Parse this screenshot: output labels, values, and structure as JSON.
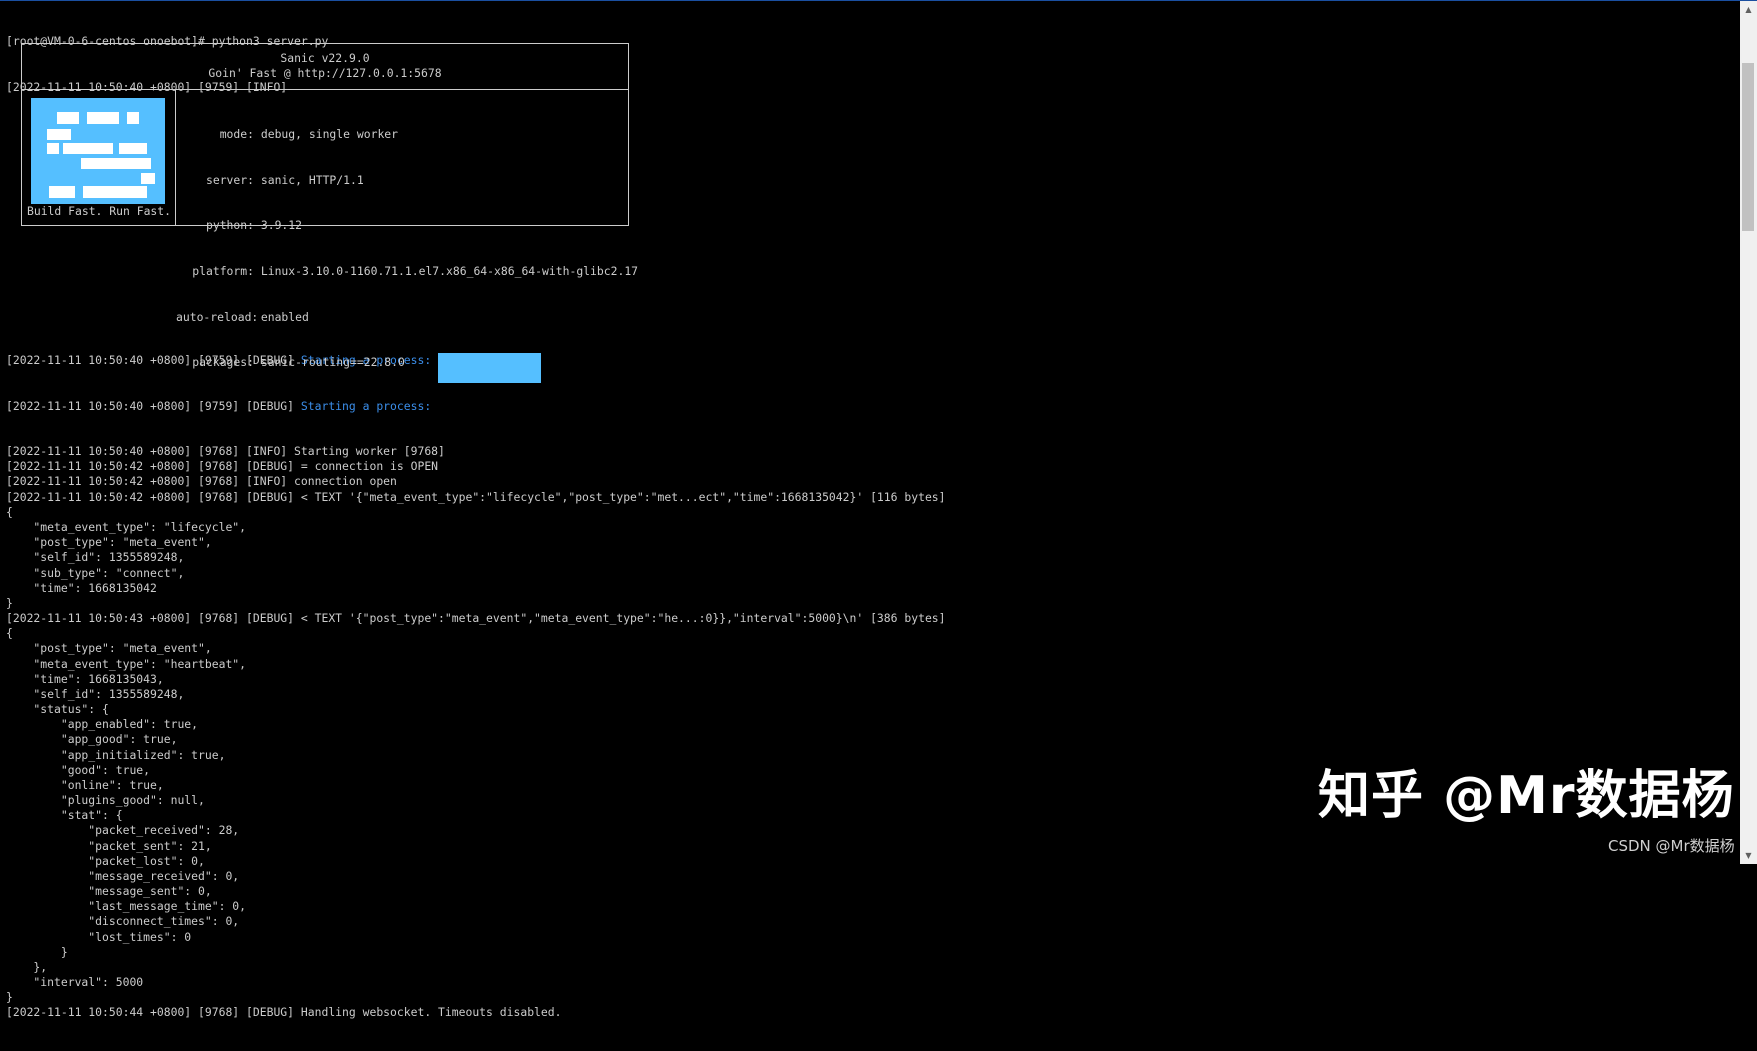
{
  "terminal": {
    "prompt_line": "[root@VM-0-6-centos onoebot]# python3 server.py",
    "info_line": "[2022-11-11 10:50:40 +0800] [9759] [INFO]",
    "sanic": {
      "version": "Sanic v22.9.0",
      "tagline": "Goin' Fast @ http://127.0.0.1:5678",
      "logo_caption": "Build Fast. Run Fast.",
      "info": [
        {
          "key": "mode:",
          "value": "debug, single worker"
        },
        {
          "key": "server:",
          "value": "sanic, HTTP/1.1"
        },
        {
          "key": "python:",
          "value": "3.9.12"
        },
        {
          "key": "platform:",
          "value": "Linux-3.10.0-1160.71.1.el7.x86_64-x86_64-with-glibc2.17"
        },
        {
          "key": "auto-reload:",
          "value": "enabled"
        },
        {
          "key": "packages:",
          "value": "sanic-routing==22.8.0"
        }
      ]
    },
    "debug_prefix": "[2022-11-11 10:50:40 +0800] [9759] [DEBUG] ",
    "starting_process": "Starting a process:",
    "log_lines": [
      "[2022-11-11 10:50:40 +0800] [9768] [INFO] Starting worker [9768]",
      "[2022-11-11 10:50:42 +0800] [9768] [DEBUG] = connection is OPEN",
      "[2022-11-11 10:50:42 +0800] [9768] [INFO] connection open",
      "[2022-11-11 10:50:42 +0800] [9768] [DEBUG] < TEXT '{\"meta_event_type\":\"lifecycle\",\"post_type\":\"met...ect\",\"time\":1668135042}' [116 bytes]",
      "{",
      "    \"meta_event_type\": \"lifecycle\",",
      "    \"post_type\": \"meta_event\",",
      "    \"self_id\": 1355589248,",
      "    \"sub_type\": \"connect\",",
      "    \"time\": 1668135042",
      "}",
      "[2022-11-11 10:50:43 +0800] [9768] [DEBUG] < TEXT '{\"post_type\":\"meta_event\",\"meta_event_type\":\"he...:0}},\"interval\":5000}\\n' [386 bytes]",
      "{",
      "    \"post_type\": \"meta_event\",",
      "    \"meta_event_type\": \"heartbeat\",",
      "    \"time\": 1668135043,",
      "    \"self_id\": 1355589248,",
      "    \"status\": {",
      "        \"app_enabled\": true,",
      "        \"app_good\": true,",
      "        \"app_initialized\": true,",
      "        \"good\": true,",
      "        \"online\": true,",
      "        \"plugins_good\": null,",
      "        \"stat\": {",
      "            \"packet_received\": 28,",
      "            \"packet_sent\": 21,",
      "            \"packet_lost\": 0,",
      "            \"message_received\": 0,",
      "            \"message_sent\": 0,",
      "            \"last_message_time\": 0,",
      "            \"disconnect_times\": 0,",
      "            \"lost_times\": 0",
      "        }",
      "    },",
      "    \"interval\": 5000",
      "}",
      "[2022-11-11 10:50:44 +0800] [9768] [DEBUG] Handling websocket. Timeouts disabled."
    ]
  },
  "watermark": {
    "main": "知乎 @Mr数据杨",
    "corner": "CSDN @Mr数据杨"
  },
  "colors": {
    "background": "#000000",
    "text": "#cccccc",
    "highlight": "#3b8eea",
    "sanic_blue": "#55bfff"
  }
}
